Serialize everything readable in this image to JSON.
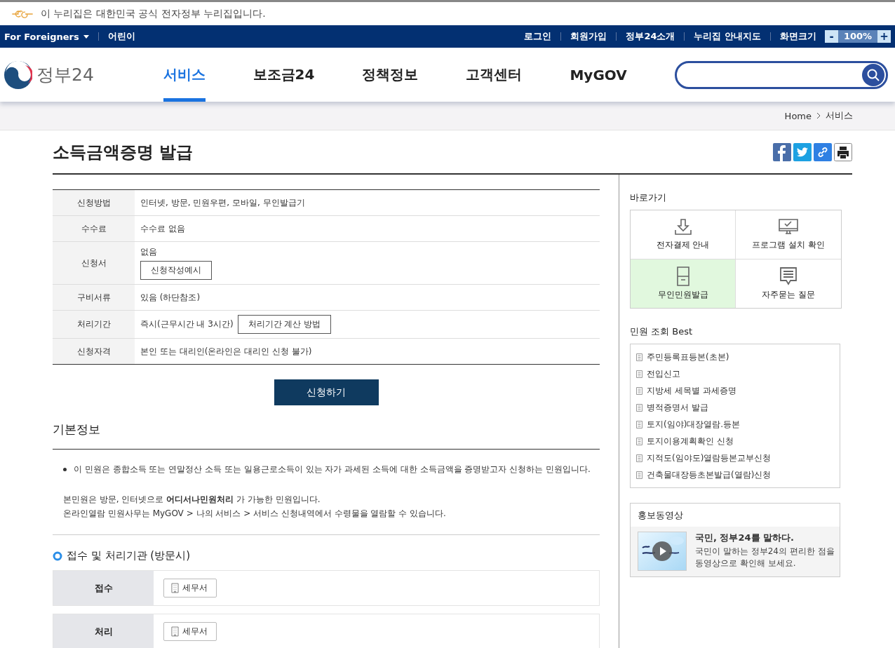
{
  "notice": {
    "text": "이 누리집은 대한민국 공식 전자정부 누리집입니다."
  },
  "topbar": {
    "left": [
      {
        "label": "For Foreigners",
        "kind": "dropdown"
      },
      {
        "label": "어린이",
        "kind": "link"
      }
    ],
    "right": [
      "로그인",
      "회원가입",
      "정부24소개",
      "누리집 안내지도"
    ],
    "zoom": {
      "label": "화면크기",
      "minus": "-",
      "value": "100%",
      "plus": "+"
    }
  },
  "header": {
    "logo": "정부24",
    "nav": [
      {
        "label": "서비스",
        "selected": true
      },
      {
        "label": "보조금24",
        "selected": false
      },
      {
        "label": "정책정보",
        "selected": false
      },
      {
        "label": "고객센터",
        "selected": false
      },
      {
        "label": "MyGOV",
        "selected": false
      }
    ]
  },
  "breadcrumb": [
    "Home",
    "서비스"
  ],
  "title": "소득금액증명 발급",
  "info_rows": [
    {
      "label": "신청방법",
      "kind": "text",
      "value": "인터넷, 방문, 민원우편, 모바일, 무인발급기"
    },
    {
      "label": "수수료",
      "kind": "text",
      "value": "수수료 없음"
    },
    {
      "label": "신청서",
      "kind": "button_below",
      "value": "없음",
      "button": "신청작성예시"
    },
    {
      "label": "구비서류",
      "kind": "text",
      "value": "있음 (하단참조)"
    },
    {
      "label": "처리기간",
      "kind": "button_inline",
      "value": "즉시(근무시간 내 3시간)",
      "button": "처리기간 계산 방법"
    },
    {
      "label": "신청자격",
      "kind": "text",
      "value": "본인 또는 대리인(온라인은 대리인 신청 불가)"
    }
  ],
  "apply_button": "신청하기",
  "basic_info": {
    "heading": "기본정보",
    "bullet": "이 민원은 종합소득 또는 연말정산 소득 또는 일용근로소득이 있는 자가 과세된 소득에 대한 소득금액을 증명받고자 신청하는 민원입니다.",
    "notes": [
      "본민원은 방문, 인터넷으로 **어디서나민원처리** 가 가능한 민원입니다.",
      "온라인열람 민원사무는 MyGOV > 나의 서비스 > 서비스 신청내역에서 수령물을 열람할 수 있습니다."
    ]
  },
  "offices": {
    "heading": "접수 및 처리기관 (방문시)",
    "rows": [
      {
        "label": "접수",
        "office": "세무서"
      },
      {
        "label": "처리",
        "office": "세무서"
      }
    ]
  },
  "sidebar": {
    "shortcuts": {
      "heading": "바로가기",
      "items": [
        {
          "label": "전자결제 안내",
          "kind": "download",
          "selected": false
        },
        {
          "label": "프로그램 설치 확인",
          "kind": "monitor",
          "selected": false
        },
        {
          "label": "무인민원발급",
          "kind": "kiosk",
          "selected": true
        },
        {
          "label": "자주묻는 질문",
          "kind": "chat",
          "selected": false
        }
      ]
    },
    "best": {
      "heading": "민원 조회 Best",
      "items": [
        "주민등록표등본(초본)",
        "전입신고",
        "지방세 세목별 과세증명",
        "병적증명서 발급",
        "토지(임야)대장열람.등본",
        "토지이용계획확인 신청",
        "지적도(임야도)열람등본교부신청",
        "건축물대장등초본발급(열람)신청"
      ]
    },
    "video": {
      "heading": "홍보동영상",
      "title": "국민, 정부24를 말하다.",
      "description_lines": [
        "국민이 말하는 정부24의 편리한 점을",
        "동영상으로 확인해 보세요."
      ]
    }
  }
}
